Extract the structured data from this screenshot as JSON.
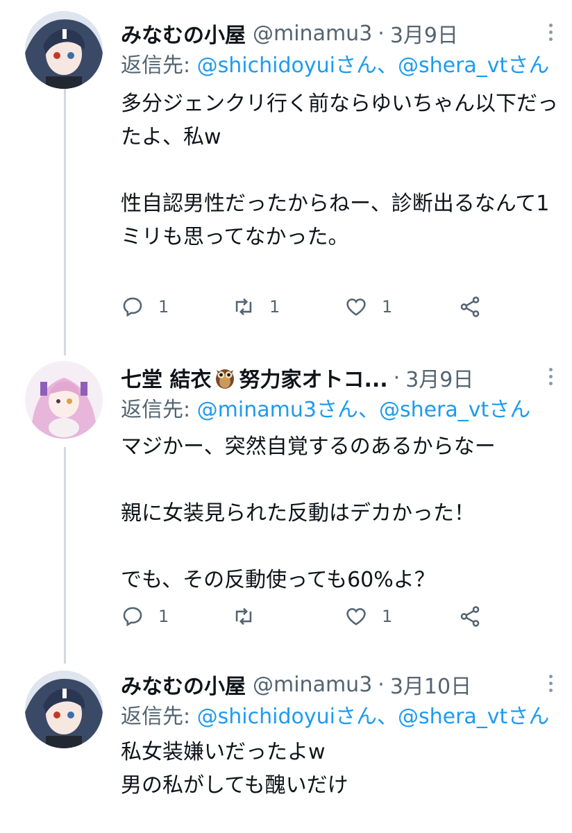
{
  "tweets": [
    {
      "name": "みなむの小屋",
      "handle": "@minamu3",
      "separator": "·",
      "date": "3月9日",
      "reply_prefix": "返信先: ",
      "reply_mention_1": "@shichidoyuiさん",
      "reply_sep": "、",
      "reply_mention_2": "@shera_vtさん",
      "text": "多分ジェンクリ行く前ならゆいちゃん以下だったよ、私w\n\n性自認男性だったからねー、診断出るなんて1ミリも思ってなかった。",
      "reply_count": "1",
      "retweet_count": "1",
      "like_count": "1",
      "icons": [
        "reply-icon",
        "retweet-icon",
        "like-icon",
        "share-icon",
        "more-icon"
      ]
    },
    {
      "name": "七堂 結衣",
      "name_suffix": "努力家オトコ...",
      "emoji": "owl",
      "separator": "·",
      "date": "3月9日",
      "reply_prefix": "返信先: ",
      "reply_mention_1": "@minamu3さん",
      "reply_sep": "、",
      "reply_mention_2": "@shera_vtさん",
      "text": "マジかー、突然自覚するのあるからなー\n\n親に女装見られた反動はデカかった！\n\nでも、その反動使っても60%よ？",
      "reply_count": "1",
      "retweet_count": "",
      "like_count": "1",
      "icons": [
        "reply-icon",
        "retweet-icon",
        "like-icon",
        "share-icon",
        "more-icon"
      ]
    },
    {
      "name": "みなむの小屋",
      "handle": "@minamu3",
      "separator": "·",
      "date": "3月10日",
      "reply_prefix": "返信先: ",
      "reply_mention_1": "@shichidoyuiさん",
      "reply_sep": "、",
      "reply_mention_2": "@shera_vtさん",
      "text": "私女装嫌いだったよw\n男の私がしても醜いだけ"
    }
  ],
  "colors": {
    "text": "#0f1419",
    "secondary": "#536471",
    "link": "#1d9bf0",
    "thread_line": "#cfd9de"
  }
}
